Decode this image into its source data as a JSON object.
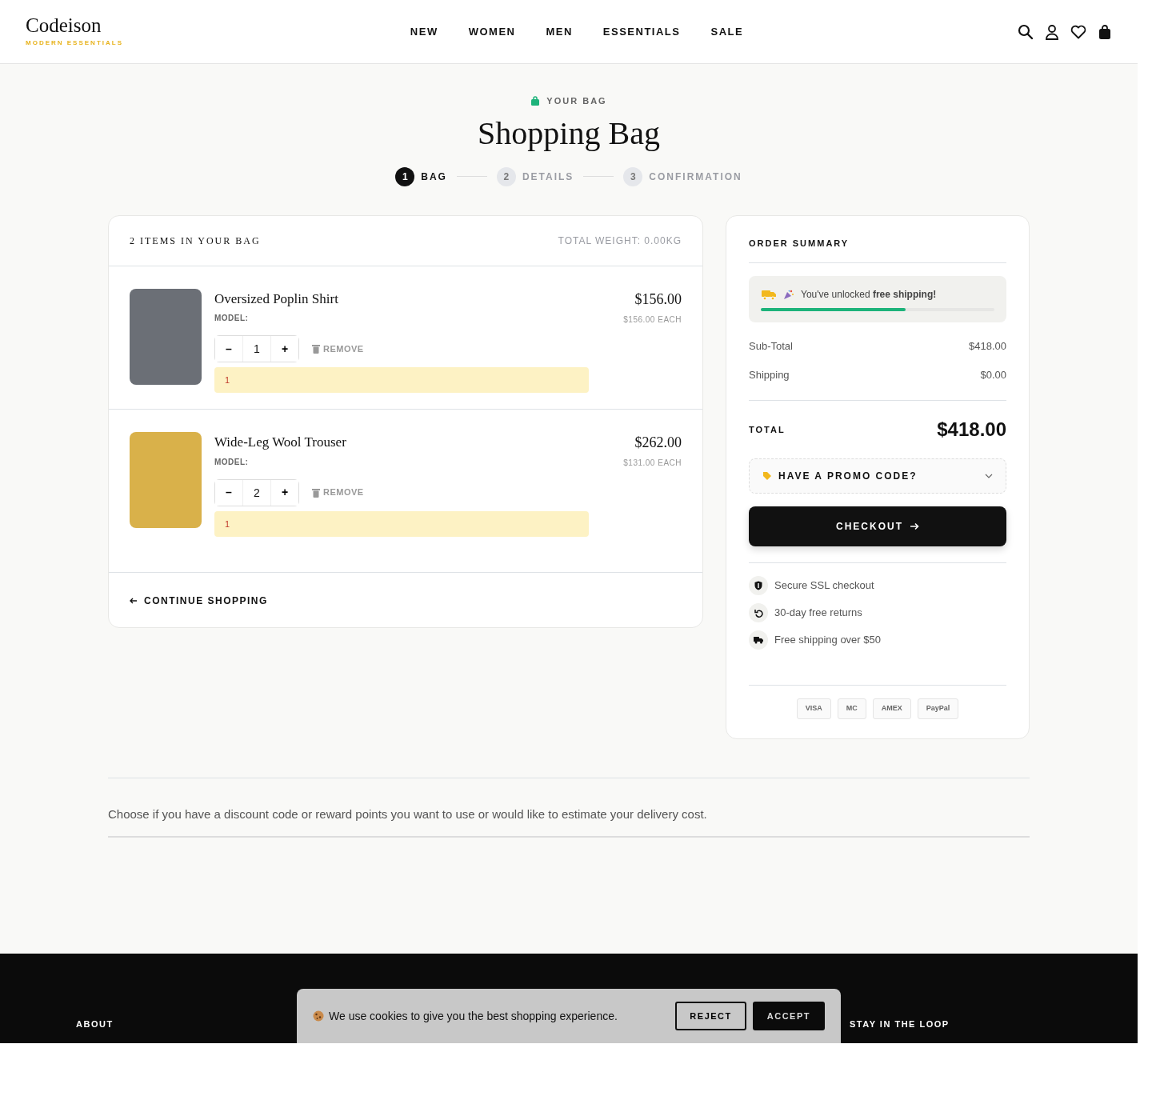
{
  "header": {
    "logo": "Codeison",
    "tagline": "MODERN ESSENTIALS",
    "nav": [
      {
        "label": "NEW"
      },
      {
        "label": "WOMEN"
      },
      {
        "label": "MEN"
      },
      {
        "label": "ESSENTIALS"
      },
      {
        "label": "SALE"
      }
    ]
  },
  "hero": {
    "eyebrow": "YOUR BAG",
    "title": "Shopping Bag",
    "steps": [
      {
        "number": "1",
        "label": "BAG",
        "selected": true
      },
      {
        "number": "2",
        "label": "DETAILS",
        "selected": false
      },
      {
        "number": "3",
        "label": "CONFIRMATION",
        "selected": false
      }
    ]
  },
  "cart": {
    "count_label": "2 ITEMS IN YOUR BAG",
    "weight": "TOTAL WEIGHT: 0.00KG",
    "items": [
      {
        "name": "Oversized Poplin Shirt",
        "model_label": "MODEL:",
        "quantity": "1",
        "remove": "REMOVE",
        "notice": "1",
        "price": "$156.00",
        "each": "$156.00 EACH",
        "decrement": "–",
        "increment": "+"
      },
      {
        "name": "Wide-Leg Wool Trouser",
        "model_label": "MODEL:",
        "quantity": "2",
        "remove": "REMOVE",
        "notice": "1",
        "price": "$262.00",
        "each": "$131.00 EACH",
        "decrement": "–",
        "increment": "+"
      }
    ],
    "continue": "CONTINUE SHOPPING"
  },
  "summary": {
    "title": "ORDER SUMMARY",
    "shipping_banner": {
      "text": "You've unlocked **free shipping!**",
      "level": 0.62
    },
    "lines": [
      {
        "label": "Sub-Total",
        "value": "$418.00"
      },
      {
        "label": "Shipping",
        "value": "$0.00"
      }
    ],
    "total": {
      "label": "TOTAL",
      "value": "$418.00"
    },
    "promo": "HAVE A PROMO CODE?",
    "checkout": "CHECKOUT",
    "assurances": [
      {
        "kind": "shield",
        "text": "Secure SSL checkout"
      },
      {
        "kind": "returns",
        "text": "30-day free returns"
      },
      {
        "kind": "truck",
        "text": "Free shipping over $50"
      }
    ],
    "payments": [
      "VISA",
      "MC",
      "AMEX",
      "PayPal"
    ]
  },
  "note": "Choose if you have a discount code or reward points you want to use or would like to estimate your delivery cost.",
  "footer": {
    "headings": [
      "ABOUT",
      "STAY IN THE LOOP"
    ]
  },
  "cookie_banner": {
    "text": "We use cookies to give you the best shopping experience.",
    "reject": "REJECT",
    "accept": "ACCEPT"
  }
}
